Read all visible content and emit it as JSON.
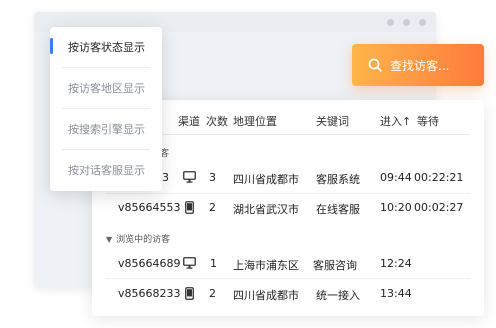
{
  "search": {
    "label": "查找访客...",
    "icon": "search-icon"
  },
  "menu": {
    "items": [
      {
        "label": "按访客状态显示",
        "active": true
      },
      {
        "label": "按访客地区显示",
        "active": false
      },
      {
        "label": "按搜索引擎显示",
        "active": false
      },
      {
        "label": "按对话客服显示",
        "active": false
      }
    ]
  },
  "table": {
    "headers": {
      "channel": "渠道",
      "count": "次数",
      "location": "地理位置",
      "keyword": "关键词",
      "enter": "进入↑",
      "wait": "等待"
    },
    "groups": [
      {
        "label_partial": "客",
        "rows": [
          {
            "id_partial": "3",
            "device": "desktop-icon",
            "count": "3",
            "location": "四川省成都市",
            "keyword": "客服系统",
            "enter": "09:44",
            "wait": "00:22:21"
          },
          {
            "id": "v85664553",
            "device": "mobile-icon",
            "count": "2",
            "location": "湖北省武汉市",
            "keyword": "在线客服",
            "enter": "10:20",
            "wait": "00:02:27"
          }
        ]
      },
      {
        "label": "浏览中的访客",
        "rows": [
          {
            "id": "v85664689",
            "device": "desktop-icon",
            "count": "1",
            "location": "上海市浦东区",
            "keyword": "客服咨询",
            "enter": "12:24",
            "wait": ""
          },
          {
            "id": "v85668233",
            "device": "mobile-icon",
            "count": "2",
            "location": "四川省成都市",
            "keyword": "统一接入",
            "enter": "13:44",
            "wait": ""
          }
        ]
      }
    ]
  },
  "colors": {
    "accent": "#3d7cf5",
    "search_start": "#ffb54a",
    "search_end": "#ff7a3c"
  }
}
